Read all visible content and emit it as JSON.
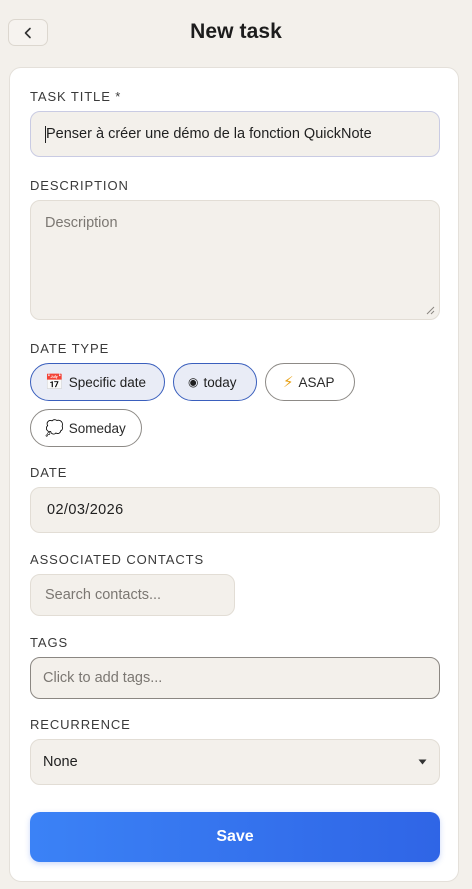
{
  "header": {
    "title": "New task",
    "back_icon": "chevron-left-icon"
  },
  "form": {
    "task_title": {
      "label": "TASK TITLE *",
      "value": "Penser à créer une démo de la fonction QuickNote"
    },
    "description": {
      "label": "DESCRIPTION",
      "placeholder": "Description"
    },
    "date_type": {
      "label": "DATE TYPE",
      "options": [
        {
          "icon": "📅",
          "label": "Specific date",
          "selected": true
        },
        {
          "icon": "◉",
          "label": "today",
          "selected": true
        },
        {
          "icon": "⚡",
          "label": "ASAP",
          "selected": false
        },
        {
          "icon": "💭",
          "label": "Someday",
          "selected": false
        }
      ]
    },
    "date": {
      "label": "DATE",
      "value": "02/03/2026"
    },
    "contacts": {
      "label": "ASSOCIATED CONTACTS",
      "placeholder": "Search contacts..."
    },
    "tags": {
      "label": "TAGS",
      "placeholder": "Click to add tags..."
    },
    "recurrence": {
      "label": "RECURRENCE",
      "value": "None"
    },
    "save_label": "Save"
  },
  "colors": {
    "accent": "#2f65e6",
    "page_bg": "#f3f0eb",
    "selected_chip_border": "#3a5fbd"
  }
}
